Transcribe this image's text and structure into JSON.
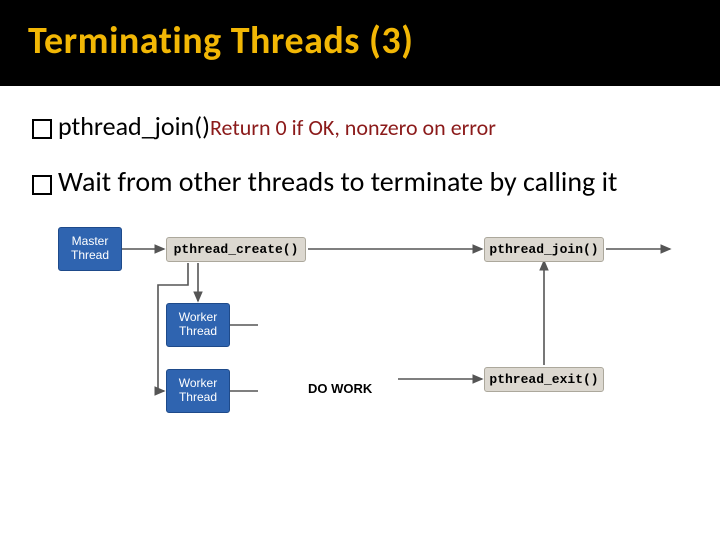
{
  "title": "Terminating Threads (3)",
  "bullet1": {
    "fn": "pthread_join()",
    "ret": "Return 0 if OK, nonzero on error"
  },
  "bullet2": "Wait from other threads to terminate by calling it",
  "diagram": {
    "master": "Master\nThread",
    "worker": "Worker\nThread",
    "pcreate": "pthread_create()",
    "pjoin": "pthread_join()",
    "pexit": "pthread_exit()",
    "dowork": "DO WORK"
  }
}
